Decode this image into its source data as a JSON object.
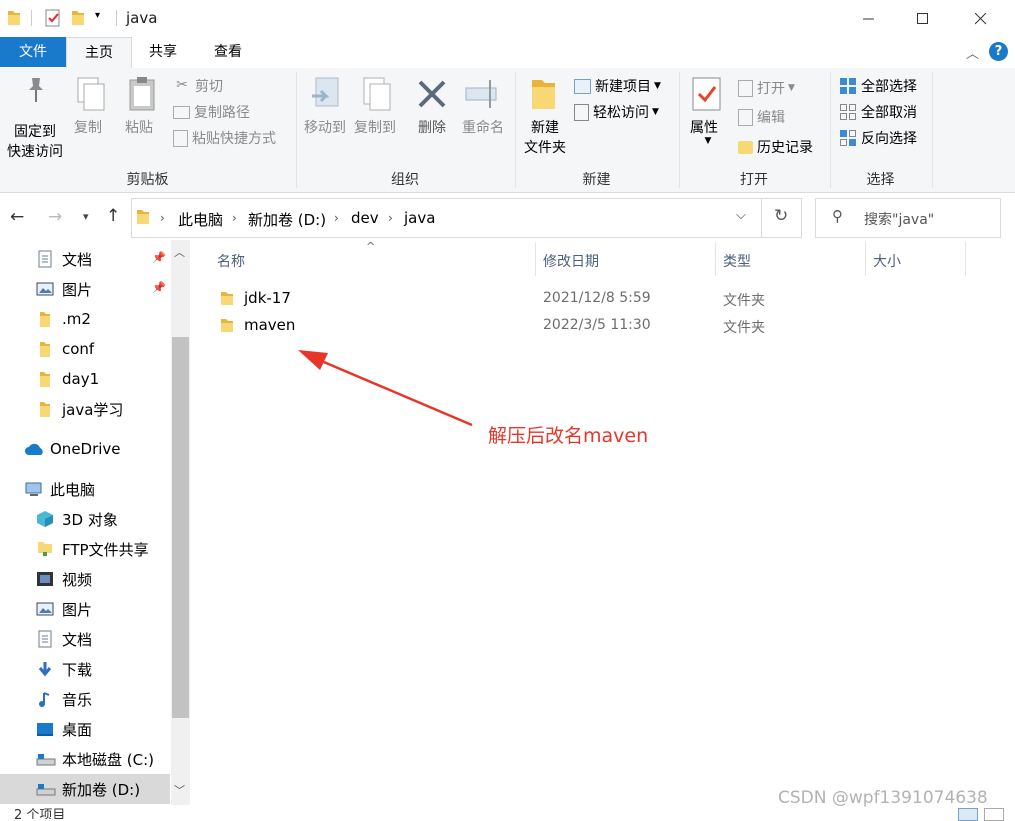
{
  "window": {
    "title": "java"
  },
  "ribbon_tabs": [
    "文件",
    "主页",
    "共享",
    "查看"
  ],
  "clipboard": {
    "pin_label_line1": "固定到",
    "pin_label_line2": "快速访问",
    "copy": "复制",
    "paste": "粘贴",
    "cut": "剪切",
    "copy_path": "复制路径",
    "paste_shortcut": "粘贴快捷方式",
    "group": "剪贴板"
  },
  "organize": {
    "move_to": "移动到",
    "copy_to": "复制到",
    "delete": "删除",
    "rename": "重命名",
    "group": "组织"
  },
  "new": {
    "new_folder_line1": "新建",
    "new_folder_line2": "文件夹",
    "new_item": "新建项目",
    "easy_access": "轻松访问",
    "group": "新建"
  },
  "open": {
    "properties": "属性",
    "open": "打开",
    "edit": "编辑",
    "history": "历史记录",
    "group": "打开"
  },
  "select": {
    "select_all": "全部选择",
    "select_none": "全部取消",
    "invert": "反向选择",
    "group": "选择"
  },
  "breadcrumb": [
    "此电脑",
    "新加卷 (D:)",
    "dev",
    "java"
  ],
  "search": {
    "placeholder": "搜索\"java\""
  },
  "nav_pane": [
    {
      "label": "文档",
      "icon": "document-icon",
      "pinned": true
    },
    {
      "label": "图片",
      "icon": "picture-icon",
      "pinned": true
    },
    {
      "label": ".m2",
      "icon": "folder-icon"
    },
    {
      "label": "conf",
      "icon": "folder-icon"
    },
    {
      "label": "day1",
      "icon": "folder-icon"
    },
    {
      "label": "java学习",
      "icon": "folder-icon"
    },
    {
      "label": "OneDrive",
      "icon": "cloud-icon"
    },
    {
      "label": "此电脑",
      "icon": "computer-icon"
    },
    {
      "label": "3D 对象",
      "icon": "cube-icon"
    },
    {
      "label": "FTP文件共享",
      "icon": "network-folder-icon"
    },
    {
      "label": "视频",
      "icon": "video-icon"
    },
    {
      "label": "图片",
      "icon": "picture-icon"
    },
    {
      "label": "文档",
      "icon": "document-icon"
    },
    {
      "label": "下载",
      "icon": "download-icon"
    },
    {
      "label": "音乐",
      "icon": "music-icon"
    },
    {
      "label": "桌面",
      "icon": "desktop-icon"
    },
    {
      "label": "本地磁盘 (C:)",
      "icon": "drive-icon"
    },
    {
      "label": "新加卷 (D:)",
      "icon": "drive-icon",
      "selected": true
    }
  ],
  "columns": [
    "名称",
    "修改日期",
    "类型",
    "大小"
  ],
  "files": [
    {
      "name": "jdk-17",
      "modified": "2021/12/8 5:59",
      "type": "文件夹"
    },
    {
      "name": "maven",
      "modified": "2022/3/5 11:30",
      "type": "文件夹"
    }
  ],
  "status": {
    "item_count": "2 个项目"
  },
  "annotation": {
    "text": "解压后改名maven",
    "color": "#e8352a"
  },
  "watermark": "CSDN @wpf1391074638",
  "colors": {
    "accent": "#1979ca",
    "folder": "#f4c542",
    "annotation": "#e8352a"
  }
}
